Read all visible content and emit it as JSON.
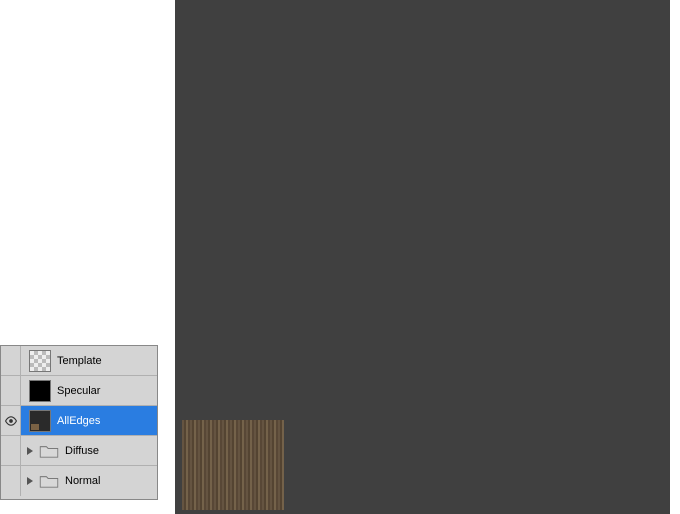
{
  "panel": {
    "layers": [
      {
        "name": "Template",
        "visible": false,
        "selected": false,
        "type": "layer",
        "thumb": "checker"
      },
      {
        "name": "Specular",
        "visible": false,
        "selected": false,
        "type": "layer",
        "thumb": "black"
      },
      {
        "name": "AllEdges",
        "visible": true,
        "selected": true,
        "type": "layer",
        "thumb": "dark"
      },
      {
        "name": "Diffuse",
        "visible": false,
        "selected": false,
        "type": "group",
        "expanded": false
      },
      {
        "name": "Normal",
        "visible": false,
        "selected": false,
        "type": "group",
        "expanded": false
      }
    ]
  },
  "canvas": {
    "background": "#404040",
    "uv_stroke": "#e8e6e0",
    "uv_shadow": "#1a1a1a",
    "wood_swatch": true
  }
}
